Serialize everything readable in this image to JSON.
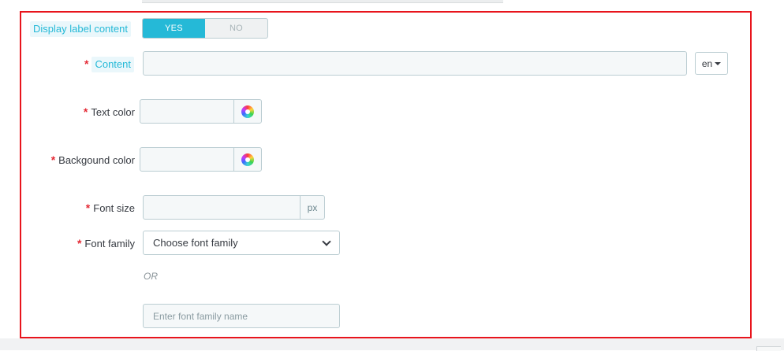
{
  "form": {
    "display_label": {
      "label": "Display label content",
      "yes_label": "YES",
      "no_label": "NO",
      "selected": "YES"
    },
    "content": {
      "label": "Content",
      "value": "",
      "language": "en"
    },
    "text_color": {
      "label": "Text color",
      "value": ""
    },
    "background_color": {
      "label": "Backgound color",
      "value": ""
    },
    "font_size": {
      "label": "Font size",
      "value": "",
      "unit": "px"
    },
    "font_family": {
      "label": "Font family",
      "selected": "Choose font family",
      "or_text": "OR",
      "custom_placeholder": "Enter font family name"
    },
    "required_marker": "*"
  },
  "colors": {
    "highlight_border": "#e8141c",
    "accent": "#25b9d7",
    "required": "#e42a35"
  }
}
